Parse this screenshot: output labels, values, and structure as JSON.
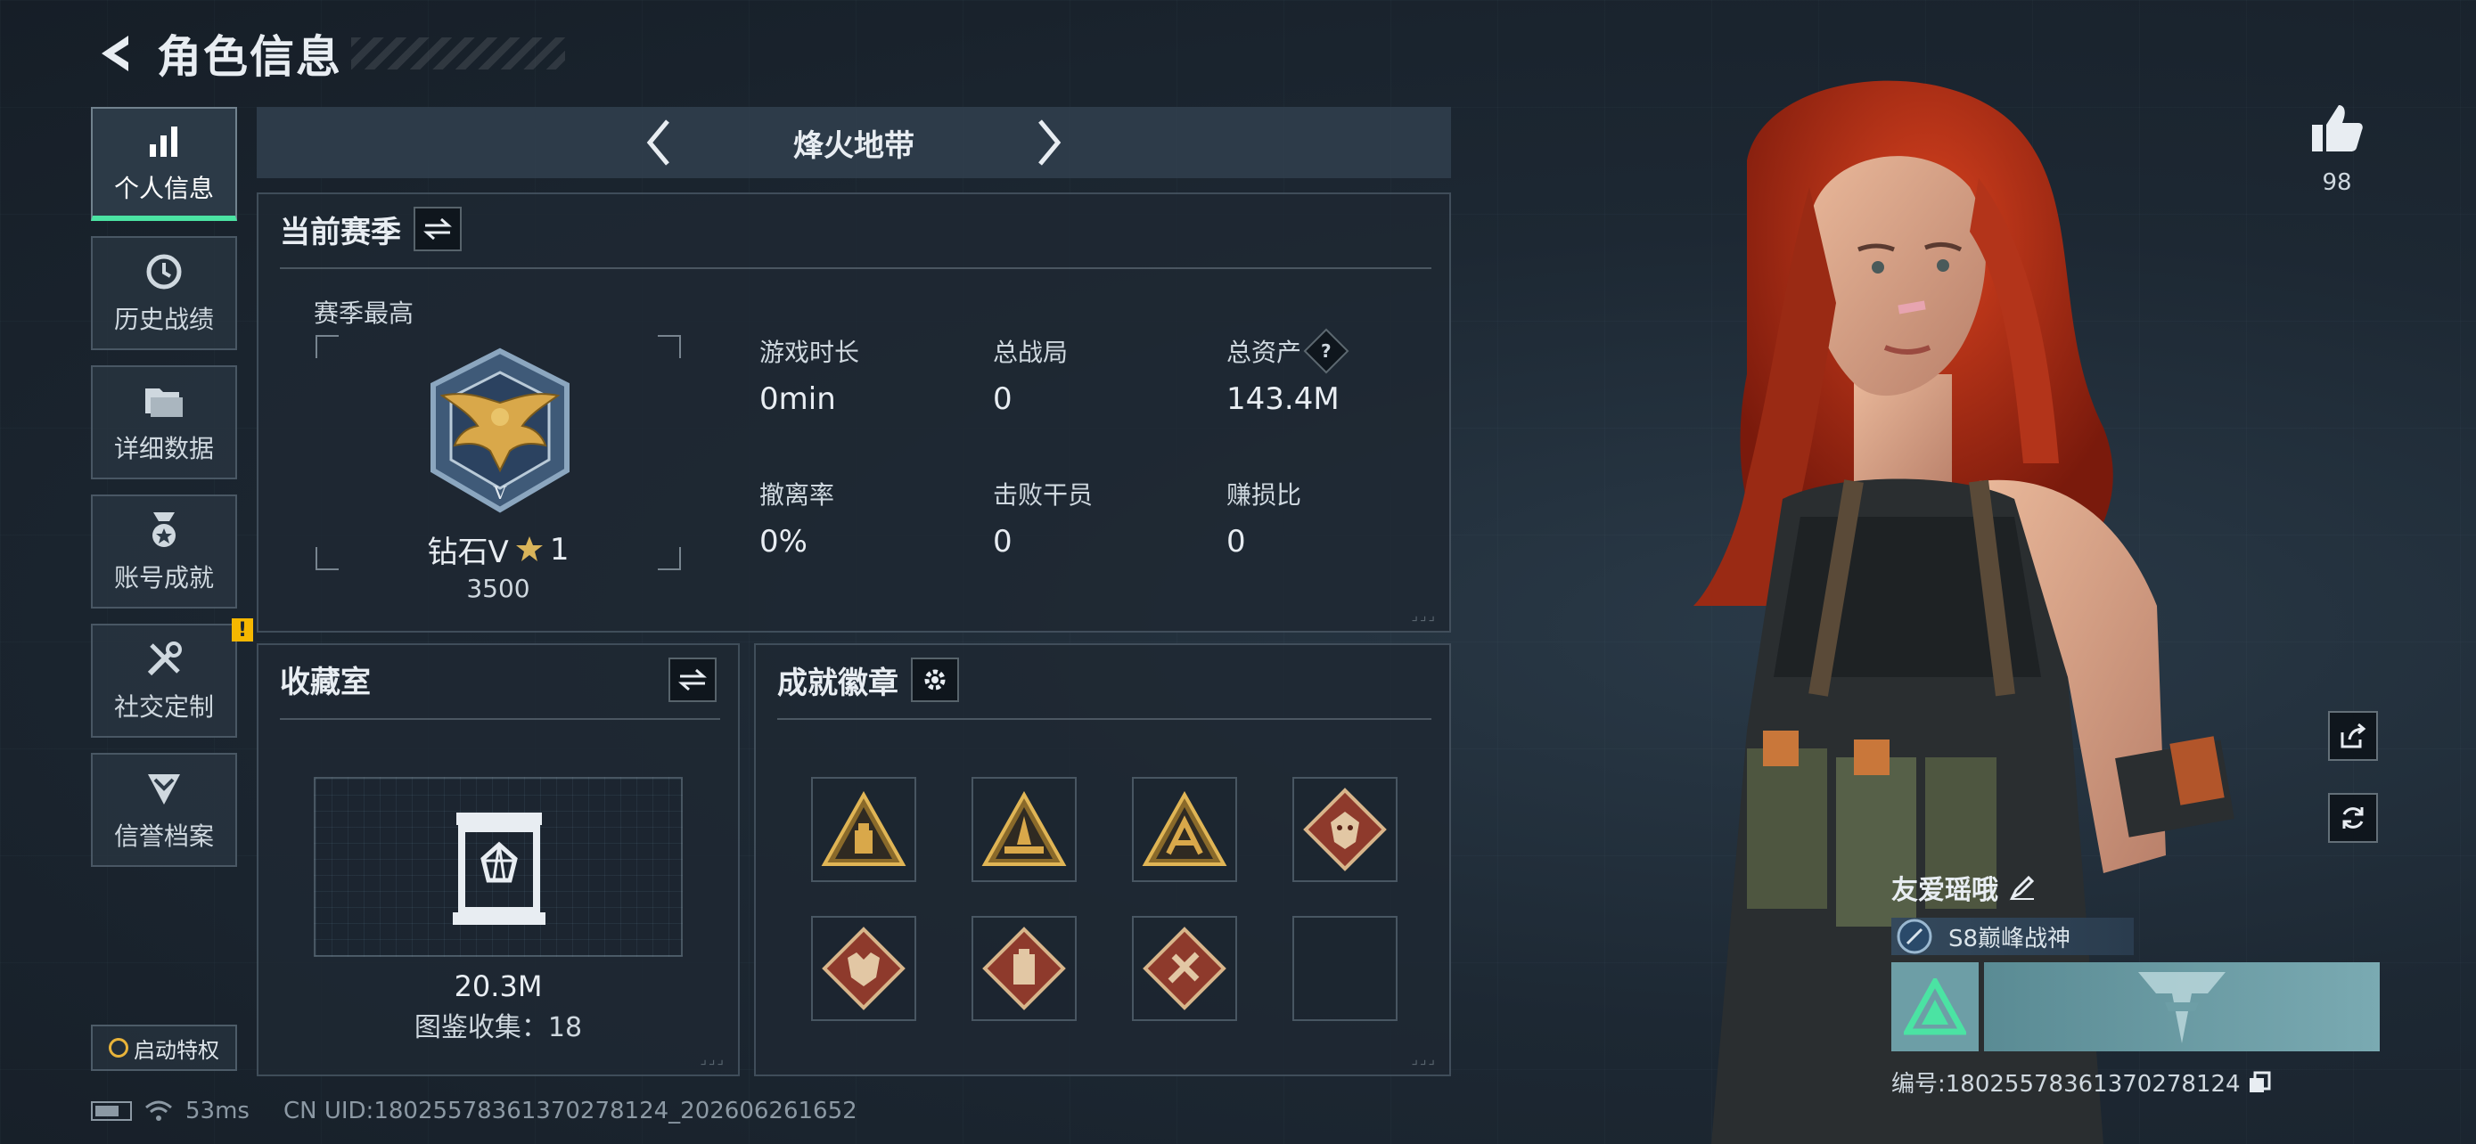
{
  "header": {
    "title": "角色信息"
  },
  "sidebar": {
    "items": [
      {
        "label": "个人信息",
        "icon": "bar-chart-icon",
        "active": true
      },
      {
        "label": "历史战绩",
        "icon": "history-clock-icon"
      },
      {
        "label": "详细数据",
        "icon": "folder-icon"
      },
      {
        "label": "账号成就",
        "icon": "medal-icon"
      },
      {
        "label": "社交定制",
        "icon": "tools-icon",
        "badge": "!"
      },
      {
        "label": "信誉档案",
        "icon": "shield-chevron-icon"
      }
    ],
    "privilege_label": "启动特权"
  },
  "mode": {
    "title": "烽火地带"
  },
  "season": {
    "title": "当前赛季",
    "peak_label": "赛季最高",
    "rank_name": "钻石V",
    "rank_stars": "1",
    "rank_score": "3500",
    "stats": [
      {
        "label": "游戏时长",
        "value": "0min"
      },
      {
        "label": "总战局",
        "value": "0"
      },
      {
        "label": "总资产",
        "value": "143.4M",
        "help": "?"
      },
      {
        "label": "撤离率",
        "value": "0%"
      },
      {
        "label": "击败干员",
        "value": "0"
      },
      {
        "label": "赚损比",
        "value": "0"
      }
    ]
  },
  "collection": {
    "title": "收藏室",
    "value": "20.3M",
    "count_text": "图鉴收集：18"
  },
  "badges": {
    "title": "成就徽章",
    "slots": [
      "triangle-badge",
      "triangle-badge",
      "triangle-badge",
      "diamond-badge",
      "diamond-badge",
      "diamond-badge",
      "diamond-badge",
      "empty"
    ]
  },
  "status": {
    "ping": "53ms",
    "uid": "CN UID:18025578361370278124_202606261652"
  },
  "player": {
    "likes": "98",
    "name": "友爱瑶哦",
    "title": "S8巅峰战神",
    "id_text": "编号:18025578361370278124"
  },
  "colors": {
    "accent": "#4be3a3",
    "warning": "#f5b700",
    "gold": "#d9a84a",
    "badge_red": "#8e3a2c"
  }
}
